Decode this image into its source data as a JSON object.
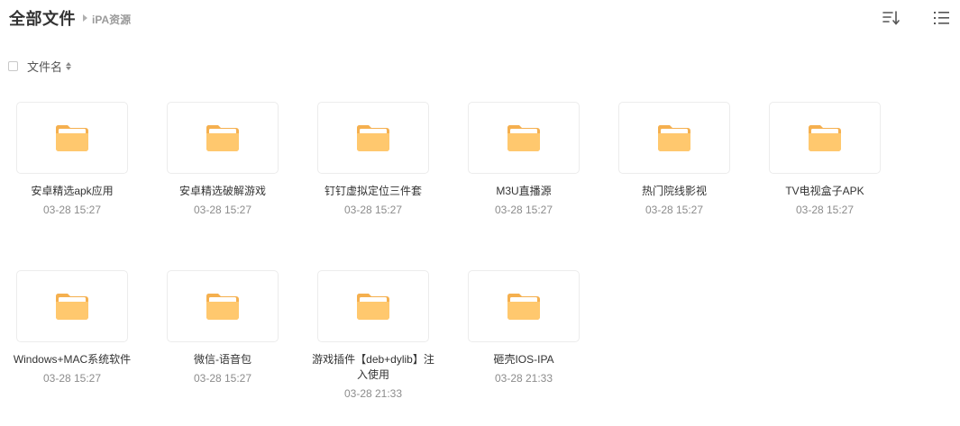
{
  "header": {
    "title": "全部文件",
    "breadcrumb": "iPA资源",
    "sort_icon": "sort-icon",
    "list_icon": "list-view-icon"
  },
  "column_header": {
    "name_label": "文件名",
    "sort_icon": "sort-arrows-icon"
  },
  "colors": {
    "folder_body": "#ffc86e",
    "folder_tab": "#f5b04f",
    "folder_paper": "#ffffff",
    "title_text": "#333333",
    "meta_text": "#8c8c8c"
  },
  "folders": [
    {
      "name": "安卓精选apk应用",
      "time": "03-28 15:27"
    },
    {
      "name": "安卓精选破解游戏",
      "time": "03-28 15:27"
    },
    {
      "name": "钉钉虚拟定位三件套",
      "time": "03-28 15:27"
    },
    {
      "name": "M3U直播源",
      "time": "03-28 15:27"
    },
    {
      "name": "热门院线影视",
      "time": "03-28 15:27"
    },
    {
      "name": "TV电视盒子APK",
      "time": "03-28 15:27"
    },
    {
      "name": "Windows+MAC系统软件",
      "time": "03-28 15:27"
    },
    {
      "name": "微信-语音包",
      "time": "03-28 15:27"
    },
    {
      "name": "游戏插件【deb+dylib】注入使用",
      "time": "03-28 21:33"
    },
    {
      "name": "砸壳IOS-IPA",
      "time": "03-28 21:33"
    }
  ]
}
